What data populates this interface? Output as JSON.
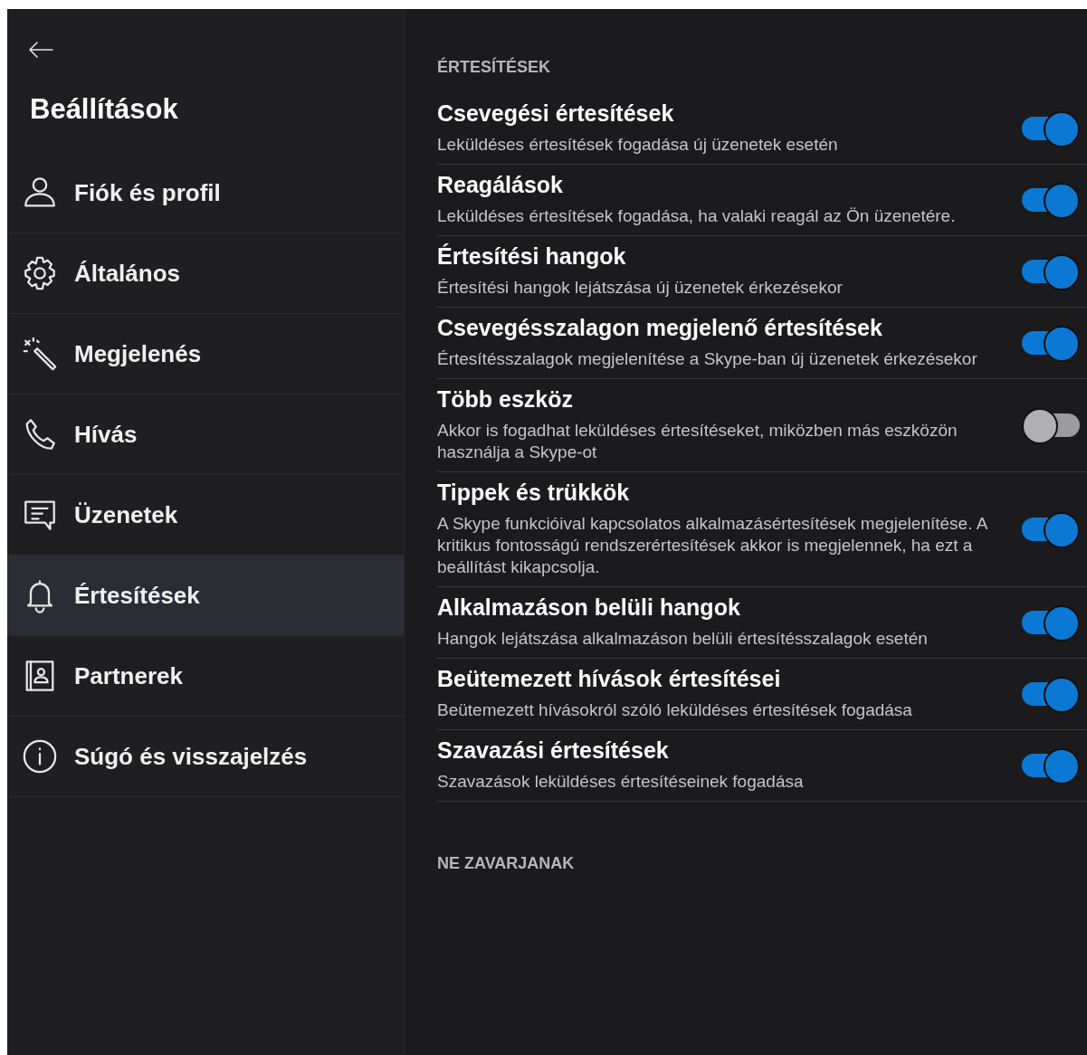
{
  "sidebar": {
    "title": "Beállítások",
    "items": [
      {
        "label": "Fiók és profil",
        "selected": false
      },
      {
        "label": "Általános",
        "selected": false
      },
      {
        "label": "Megjelenés",
        "selected": false
      },
      {
        "label": "Hívás",
        "selected": false
      },
      {
        "label": "Üzenetek",
        "selected": false
      },
      {
        "label": "Értesítések",
        "selected": true
      },
      {
        "label": "Partnerek",
        "selected": false
      },
      {
        "label": "Súgó és visszajelzés",
        "selected": false
      }
    ]
  },
  "sections": [
    {
      "header": "ÉRTESÍTÉSEK",
      "settings": [
        {
          "title": "Csevegési értesítések",
          "description": "Leküldéses értesítések fogadása új üzenetek esetén",
          "on": true
        },
        {
          "title": "Reagálások",
          "description": "Leküldéses értesítések fogadása, ha valaki reagál az Ön üzenetére.",
          "on": true
        },
        {
          "title": "Értesítési hangok",
          "description": "Értesítési hangok lejátszása új üzenetek érkezésekor",
          "on": true
        },
        {
          "title": "Csevegésszalagon megjelenő értesítések",
          "description": "Értesítésszalagok megjelenítése a Skype-ban új üzenetek érkezésekor",
          "on": true
        },
        {
          "title": "Több eszköz",
          "description": "Akkor is fogadhat leküldéses értesítéseket, miközben más eszközön használja a Skype-ot",
          "on": false
        },
        {
          "title": "Tippek és trükkök",
          "description": "A Skype funkcióival kapcsolatos alkalmazásértesítések megjelenítése. A kritikus fontosságú rendszerértesítések akkor is megjelennek, ha ezt a beállítást kikapcsolja.",
          "on": true
        },
        {
          "title": "Alkalmazáson belüli hangok",
          "description": "Hangok lejátszása alkalmazáson belüli értesítésszalagok esetén",
          "on": true
        },
        {
          "title": "Beütemezett hívások értesítései",
          "description": "Beütemezett hívásokról szóló leküldéses értesítések fogadása",
          "on": true
        },
        {
          "title": "Szavazási értesítések",
          "description": "Szavazások leküldéses értesítéseinek fogadása",
          "on": true
        }
      ]
    },
    {
      "header": "NE ZAVARJANAK"
    }
  ]
}
